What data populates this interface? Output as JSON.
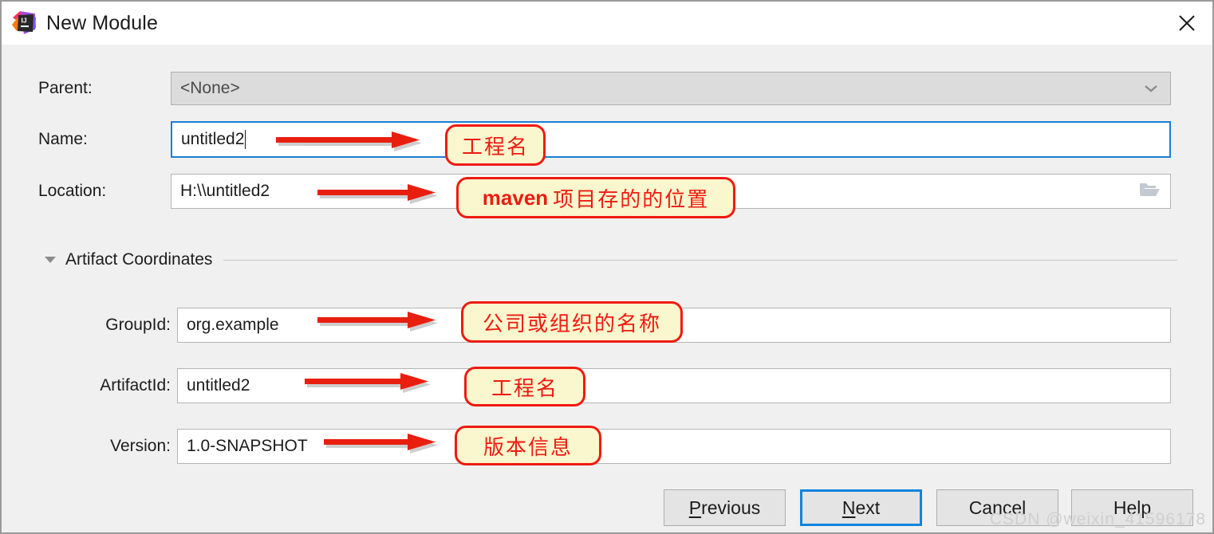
{
  "window": {
    "title": "New Module",
    "app_icon": "intellij-idea-logo",
    "close_icon": "close-icon"
  },
  "form": {
    "parent": {
      "label": "Parent:",
      "value": "<None>",
      "dropdown_icon": "chevron-down-icon",
      "enabled": false
    },
    "name": {
      "label": "Name:",
      "value": "untitled2",
      "focused": true
    },
    "location": {
      "label": "Location:",
      "value": "H:\\\\untitled2",
      "browse_icon": "folder-open-icon"
    }
  },
  "artifact_section": {
    "title": "Artifact Coordinates",
    "expand_icon": "triangle-down-icon",
    "expanded": true,
    "fields": [
      {
        "label": "GroupId:",
        "value": "org.example"
      },
      {
        "label": "ArtifactId:",
        "value": "untitled2"
      },
      {
        "label": "Version:",
        "value": "1.0-SNAPSHOT"
      }
    ]
  },
  "annotations": [
    {
      "id": "name-note",
      "text": "工程名",
      "bold_prefix": ""
    },
    {
      "id": "location-note",
      "text": "项目存的的位置",
      "bold_prefix": "maven"
    },
    {
      "id": "groupid-note",
      "text": "公司或组织的名称",
      "bold_prefix": ""
    },
    {
      "id": "artifactid-note",
      "text": "工程名",
      "bold_prefix": ""
    },
    {
      "id": "version-note",
      "text": "版本信息",
      "bold_prefix": ""
    }
  ],
  "footer": {
    "previous": {
      "label": "Previous",
      "mnemonic": "P"
    },
    "next": {
      "label": "Next",
      "mnemonic": "N",
      "default": true
    },
    "cancel": {
      "label": "Cancel"
    },
    "help": {
      "label": "Help"
    }
  },
  "watermark": "CSDN @weixin_41596178",
  "colors": {
    "accent_blue": "#1a7fd4",
    "default_button_blue": "#0f84de",
    "annotation_red": "#ee1b11",
    "annotation_fill": "#faf6cd",
    "dialog_bg": "#f0f0f0"
  }
}
